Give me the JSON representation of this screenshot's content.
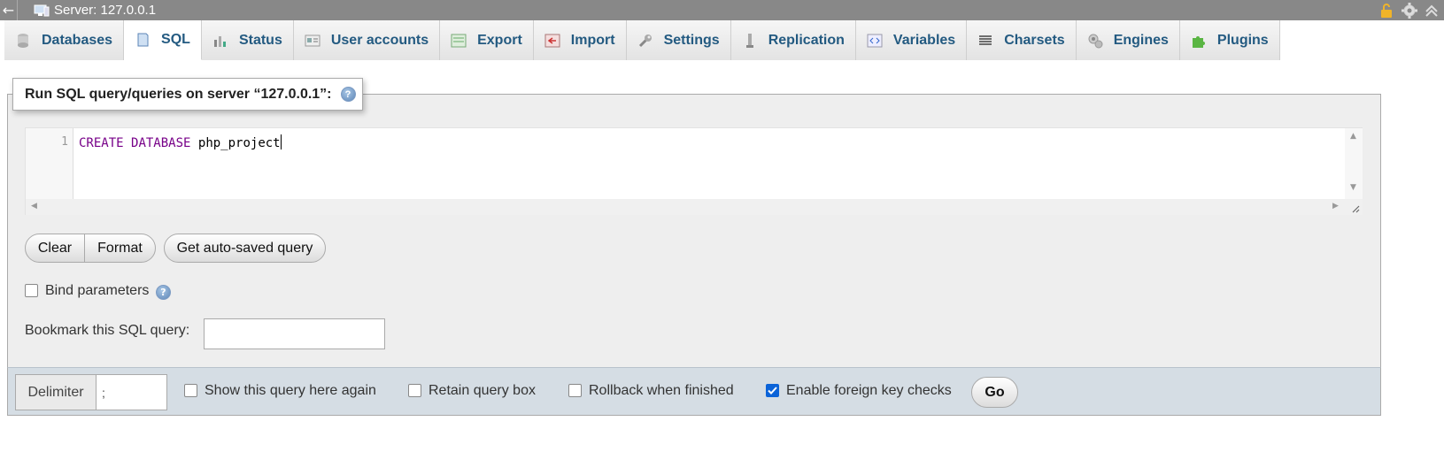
{
  "topbar": {
    "back_glyph": "←",
    "server_title": "Server: 127.0.0.1"
  },
  "tabs": [
    {
      "label": "Databases",
      "icon": "database-icon"
    },
    {
      "label": "SQL",
      "icon": "sql-icon",
      "active": true
    },
    {
      "label": "Status",
      "icon": "status-icon"
    },
    {
      "label": "User accounts",
      "icon": "user-accounts-icon"
    },
    {
      "label": "Export",
      "icon": "export-icon"
    },
    {
      "label": "Import",
      "icon": "import-icon"
    },
    {
      "label": "Settings",
      "icon": "wrench-icon"
    },
    {
      "label": "Replication",
      "icon": "replication-icon"
    },
    {
      "label": "Variables",
      "icon": "variables-icon"
    },
    {
      "label": "Charsets",
      "icon": "charsets-icon"
    },
    {
      "label": "Engines",
      "icon": "engines-icon"
    },
    {
      "label": "Plugins",
      "icon": "plugins-icon"
    }
  ],
  "query_panel": {
    "legend": "Run SQL query/queries on server “127.0.0.1”:",
    "editor": {
      "line_number": "1",
      "keyword1": "CREATE",
      "keyword2": "DATABASE",
      "identifier": "php_project"
    },
    "buttons": {
      "clear": "Clear",
      "format": "Format",
      "auto_saved": "Get auto-saved query"
    },
    "bind_parameters_label": "Bind parameters",
    "bookmark_label": "Bookmark this SQL query:",
    "bookmark_value": ""
  },
  "bottom": {
    "delimiter_label": "Delimiter",
    "delimiter_value": ";",
    "show_query_label": "Show this query here again",
    "retain_label": "Retain query box",
    "rollback_label": "Rollback when finished",
    "fk_checks_label": "Enable foreign key checks",
    "fk_checks_checked": true,
    "go_label": "Go"
  },
  "colors": {
    "tab_text": "#235a81",
    "keyword": "#770088",
    "checkbox_checked": "#0b63d8",
    "topbar": "#888888"
  }
}
